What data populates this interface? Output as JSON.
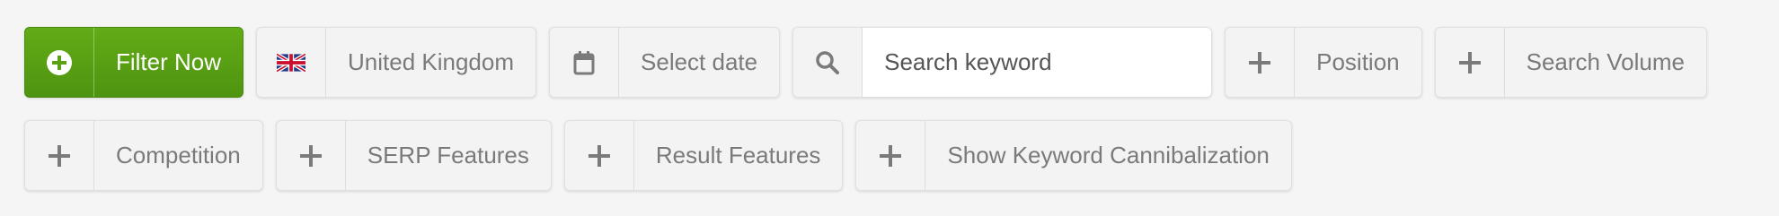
{
  "filter_bar": {
    "filter_button": {
      "label": "Filter Now",
      "icon": "circle-plus-icon"
    },
    "country": {
      "label": "United Kingdom",
      "icon": "uk-flag-icon"
    },
    "date": {
      "label": "Select date",
      "icon": "calendar-icon"
    },
    "search": {
      "placeholder": "Search keyword",
      "value": "",
      "icon": "search-icon"
    },
    "position": {
      "label": "Position",
      "icon": "plus-icon"
    },
    "search_volume": {
      "label": "Search Volume",
      "icon": "plus-icon"
    },
    "competition": {
      "label": "Competition",
      "icon": "plus-icon"
    },
    "serp_features": {
      "label": "SERP Features",
      "icon": "plus-icon"
    },
    "result_features": {
      "label": "Result Features",
      "icon": "plus-icon"
    },
    "cannibalization": {
      "label": "Show Keyword Cannibalization",
      "icon": "plus-icon"
    }
  },
  "colors": {
    "primary_green": "#5aa114",
    "chip_background": "#f3f3f3",
    "text_gray": "#7a7a7a"
  }
}
